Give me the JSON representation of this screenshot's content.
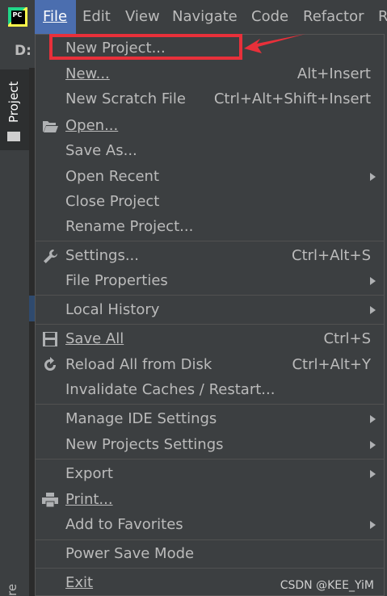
{
  "menubar": {
    "logo_text": "PC",
    "items": [
      {
        "label": "File",
        "active": true
      },
      {
        "label": "Edit"
      },
      {
        "label": "View"
      },
      {
        "label": "Navigate"
      },
      {
        "label": "Code"
      },
      {
        "label": "Refactor"
      },
      {
        "label": "R"
      }
    ]
  },
  "toolbar": {
    "drive": "D:"
  },
  "sidebar": {
    "project_label": "Project",
    "bottom_label": "re"
  },
  "file_menu": {
    "items": [
      {
        "label": "New Project...",
        "shortcut": "",
        "submenu": false,
        "icon": ""
      },
      {
        "label": "New...",
        "shortcut": "Alt+Insert",
        "submenu": false,
        "icon": ""
      },
      {
        "label": "New Scratch File",
        "shortcut": "Ctrl+Alt+Shift+Insert",
        "submenu": false,
        "icon": ""
      },
      {
        "label": "Open...",
        "shortcut": "",
        "submenu": false,
        "icon": "folder-open-icon"
      },
      {
        "label": "Save As...",
        "shortcut": "",
        "submenu": false,
        "icon": ""
      },
      {
        "label": "Open Recent",
        "shortcut": "",
        "submenu": true,
        "icon": ""
      },
      {
        "label": "Close Project",
        "shortcut": "",
        "submenu": false,
        "icon": ""
      },
      {
        "label": "Rename Project...",
        "shortcut": "",
        "submenu": false,
        "icon": ""
      },
      {
        "label": "Settings...",
        "shortcut": "Ctrl+Alt+S",
        "submenu": false,
        "icon": "wrench-icon"
      },
      {
        "label": "File Properties",
        "shortcut": "",
        "submenu": true,
        "icon": ""
      },
      {
        "label": "Local History",
        "shortcut": "",
        "submenu": true,
        "icon": ""
      },
      {
        "label": "Save All",
        "shortcut": "Ctrl+S",
        "submenu": false,
        "icon": "save-icon"
      },
      {
        "label": "Reload All from Disk",
        "shortcut": "Ctrl+Alt+Y",
        "submenu": false,
        "icon": "reload-icon"
      },
      {
        "label": "Invalidate Caches / Restart...",
        "shortcut": "",
        "submenu": false,
        "icon": ""
      },
      {
        "label": "Manage IDE Settings",
        "shortcut": "",
        "submenu": true,
        "icon": ""
      },
      {
        "label": "New Projects Settings",
        "shortcut": "",
        "submenu": true,
        "icon": ""
      },
      {
        "label": "Export",
        "shortcut": "",
        "submenu": true,
        "icon": ""
      },
      {
        "label": "Print...",
        "shortcut": "",
        "submenu": false,
        "icon": "print-icon"
      },
      {
        "label": "Add to Favorites",
        "shortcut": "",
        "submenu": true,
        "icon": ""
      },
      {
        "label": "Power Save Mode",
        "shortcut": "",
        "submenu": false,
        "icon": ""
      },
      {
        "label": "Exit",
        "shortcut": "",
        "submenu": false,
        "icon": ""
      }
    ]
  },
  "annotation": {
    "highlight_color": "#e8303a"
  },
  "watermark": "CSDN @KEE_YiM"
}
